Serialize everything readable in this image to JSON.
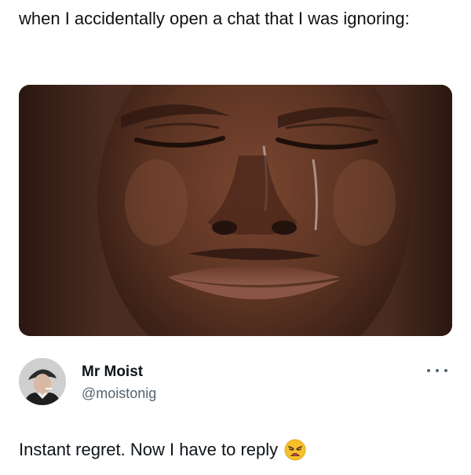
{
  "meme": {
    "caption": "when I accidentally open a chat that I was ignoring:"
  },
  "tweet": {
    "display_name": "Mr Moist",
    "handle": "@moistonig",
    "text": "Instant regret. Now I have to reply",
    "emoji": "weary-face-emoji",
    "more_icon": "more-options-icon"
  },
  "colors": {
    "text_primary": "#0f1419",
    "text_secondary": "#536471",
    "background": "#ffffff"
  }
}
